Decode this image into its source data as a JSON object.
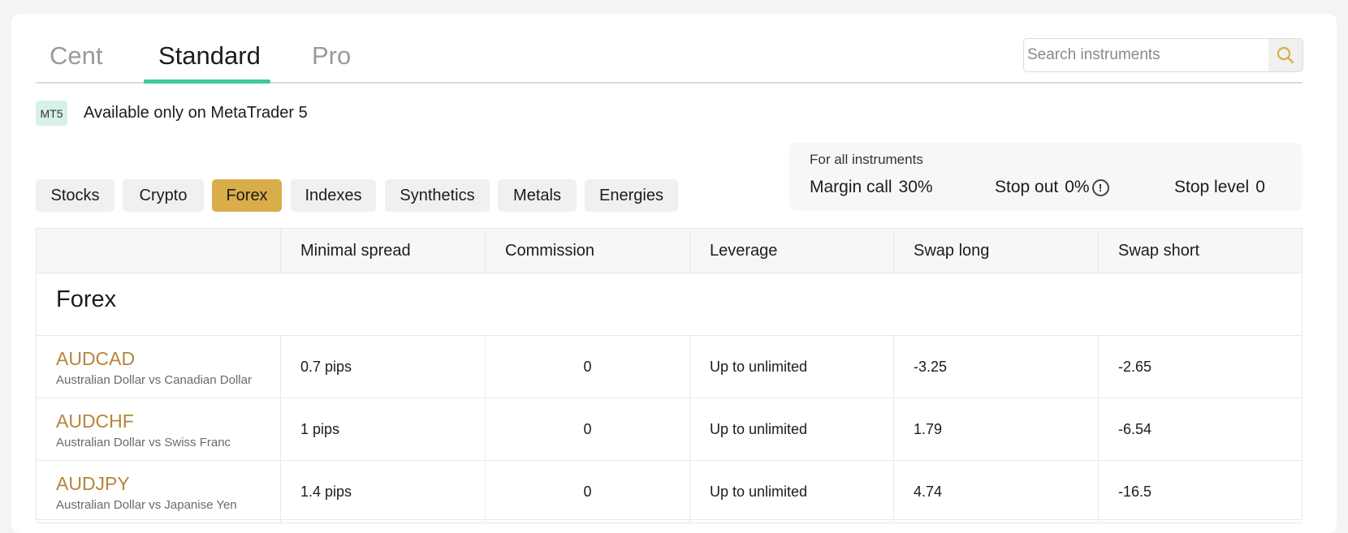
{
  "tabs": [
    {
      "label": "Cent",
      "active": false
    },
    {
      "label": "Standard",
      "active": true
    },
    {
      "label": "Pro",
      "active": false
    }
  ],
  "search": {
    "placeholder": "Search instruments",
    "icon": "search-icon"
  },
  "platform_note": {
    "badge": "MT5",
    "text": "Available only on MetaTrader 5"
  },
  "categories": [
    {
      "label": "Stocks",
      "active": false
    },
    {
      "label": "Crypto",
      "active": false
    },
    {
      "label": "Forex",
      "active": true
    },
    {
      "label": "Indexes",
      "active": false
    },
    {
      "label": "Synthetics",
      "active": false
    },
    {
      "label": "Metals",
      "active": false
    },
    {
      "label": "Energies",
      "active": false
    }
  ],
  "info": {
    "title": "For all instruments",
    "margin_call_label": "Margin call",
    "margin_call_value": "30%",
    "stop_out_label": "Stop out",
    "stop_out_value": "0%",
    "stop_level_label": "Stop level",
    "stop_level_value": "0"
  },
  "table": {
    "headers": [
      "",
      "Minimal spread",
      "Commission",
      "Leverage",
      "Swap long",
      "Swap short"
    ],
    "group": "Forex",
    "rows": [
      {
        "symbol": "AUDCAD",
        "desc": "Australian Dollar vs Canadian Dollar",
        "spread": "0.7 pips",
        "commission": "0",
        "leverage": "Up to unlimited",
        "swap_long": "-3.25",
        "swap_short": "-2.65"
      },
      {
        "symbol": "AUDCHF",
        "desc": "Australian Dollar vs Swiss Franc",
        "spread": "1 pips",
        "commission": "0",
        "leverage": "Up to unlimited",
        "swap_long": "1.79",
        "swap_short": "-6.54"
      },
      {
        "symbol": "AUDJPY",
        "desc": "Australian Dollar vs Japanise Yen",
        "spread": "1.4 pips",
        "commission": "0",
        "leverage": "Up to unlimited",
        "swap_long": "4.74",
        "swap_short": "-16.5"
      }
    ]
  },
  "colors": {
    "accent_tab": "#3fc99b",
    "accent_chip": "#d9ae49",
    "symbol": "#b5853b",
    "mt5_badge": "#d6f2e6"
  }
}
